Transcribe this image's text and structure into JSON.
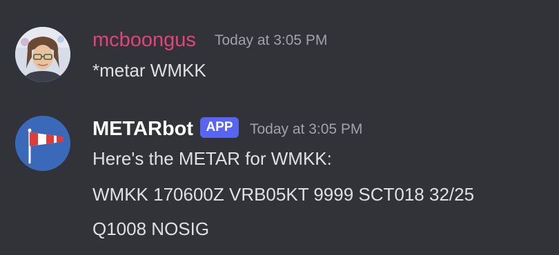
{
  "messages": [
    {
      "author": "mcboongus",
      "author_color": "#e24476",
      "timestamp": "Today at 3:05 PM",
      "lines": [
        "*metar WMKK"
      ],
      "avatar_icon": "user-photo-avatar"
    },
    {
      "author": "METARbot",
      "author_color": "#ffffff",
      "badge": "APP",
      "timestamp": "Today at 3:05 PM",
      "lines": [
        "Here's the METAR for WMKK:",
        "WMKK 170600Z VRB05KT 9999 SCT018 32/25",
        "Q1008 NOSIG"
      ],
      "avatar_icon": "windsock-icon"
    }
  ]
}
